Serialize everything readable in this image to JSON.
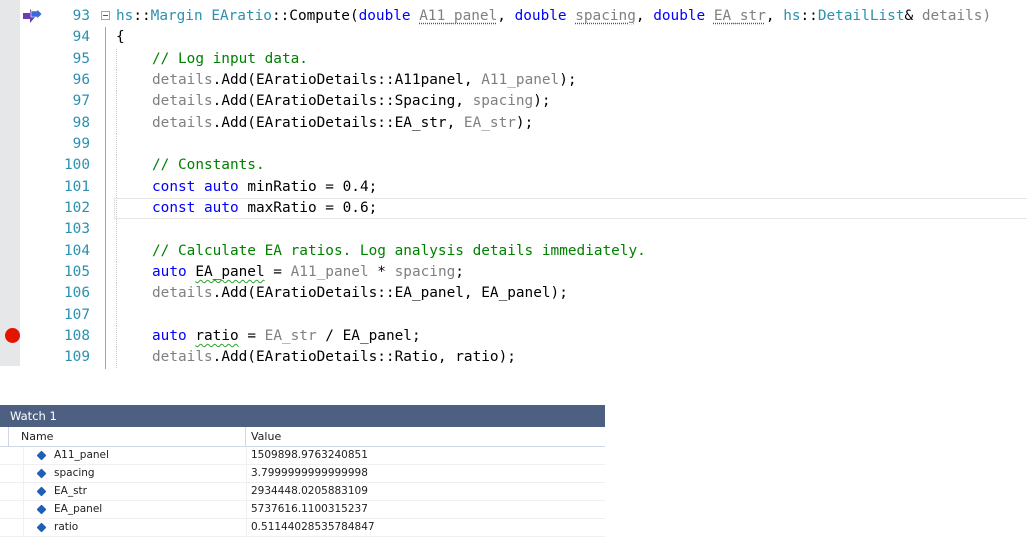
{
  "editor": {
    "lines": [
      {
        "num": "93",
        "tokens": [
          {
            "t": "hs",
            "c": "ty"
          },
          {
            "t": "::",
            "c": ""
          },
          {
            "t": "Margin",
            "c": "ty"
          },
          {
            "t": " ",
            "c": ""
          },
          {
            "t": "EAratio",
            "c": "ty"
          },
          {
            "t": "::",
            "c": ""
          },
          {
            "t": "Compute(",
            "c": ""
          },
          {
            "t": "double",
            "c": "kw"
          },
          {
            "t": " ",
            "c": ""
          },
          {
            "t": "A11_panel",
            "c": "pm dq"
          },
          {
            "t": ", ",
            "c": ""
          },
          {
            "t": "double",
            "c": "kw"
          },
          {
            "t": " ",
            "c": ""
          },
          {
            "t": "spacing",
            "c": "pm dq"
          },
          {
            "t": ", ",
            "c": ""
          },
          {
            "t": "double",
            "c": "kw"
          },
          {
            "t": " ",
            "c": ""
          },
          {
            "t": "EA_str",
            "c": "pm dq"
          },
          {
            "t": ", ",
            "c": ""
          },
          {
            "t": "hs",
            "c": "ty"
          },
          {
            "t": "::",
            "c": ""
          },
          {
            "t": "DetailList",
            "c": "ty"
          },
          {
            "t": "& ",
            "c": ""
          },
          {
            "t": "details)",
            "c": "pm"
          }
        ]
      },
      {
        "num": "94",
        "tokens": [
          {
            "t": "{",
            "c": ""
          }
        ]
      },
      {
        "num": "95",
        "indent": 1,
        "tokens": [
          {
            "t": "// Log input data.",
            "c": "cm"
          }
        ]
      },
      {
        "num": "96",
        "indent": 1,
        "tokens": [
          {
            "t": "details",
            "c": "pm"
          },
          {
            "t": ".Add(EAratioDetails::A11panel, ",
            "c": ""
          },
          {
            "t": "A11_panel",
            "c": "pm"
          },
          {
            "t": ");",
            "c": ""
          }
        ]
      },
      {
        "num": "97",
        "indent": 1,
        "tokens": [
          {
            "t": "details",
            "c": "pm"
          },
          {
            "t": ".Add(EAratioDetails::Spacing, ",
            "c": ""
          },
          {
            "t": "spacing",
            "c": "pm"
          },
          {
            "t": ");",
            "c": ""
          }
        ]
      },
      {
        "num": "98",
        "indent": 1,
        "tokens": [
          {
            "t": "details",
            "c": "pm"
          },
          {
            "t": ".Add(EAratioDetails::EA_str, ",
            "c": ""
          },
          {
            "t": "EA_str",
            "c": "pm"
          },
          {
            "t": ");",
            "c": ""
          }
        ]
      },
      {
        "num": "99",
        "indent": 1,
        "tokens": []
      },
      {
        "num": "100",
        "indent": 1,
        "tokens": [
          {
            "t": "// Constants.",
            "c": "cm"
          }
        ]
      },
      {
        "num": "101",
        "indent": 1,
        "tokens": [
          {
            "t": "const",
            "c": "kw"
          },
          {
            "t": " ",
            "c": ""
          },
          {
            "t": "auto",
            "c": "kw"
          },
          {
            "t": " minRatio = 0.4;",
            "c": ""
          }
        ]
      },
      {
        "num": "102",
        "indent": 1,
        "current": true,
        "tokens": [
          {
            "t": "const",
            "c": "kw"
          },
          {
            "t": " ",
            "c": ""
          },
          {
            "t": "auto",
            "c": "kw"
          },
          {
            "t": " maxRatio = 0.6;",
            "c": ""
          }
        ]
      },
      {
        "num": "103",
        "indent": 1,
        "tokens": []
      },
      {
        "num": "104",
        "indent": 1,
        "tokens": [
          {
            "t": "// Calculate EA ratios. Log analysis details immediately.",
            "c": "cm"
          }
        ]
      },
      {
        "num": "105",
        "indent": 1,
        "tokens": [
          {
            "t": "auto",
            "c": "kw"
          },
          {
            "t": " ",
            "c": ""
          },
          {
            "t": "EA_panel",
            "c": "sq"
          },
          {
            "t": " = ",
            "c": ""
          },
          {
            "t": "A11_panel",
            "c": "pm"
          },
          {
            "t": " * ",
            "c": ""
          },
          {
            "t": "spacing",
            "c": "pm"
          },
          {
            "t": ";",
            "c": ""
          }
        ]
      },
      {
        "num": "106",
        "indent": 1,
        "tokens": [
          {
            "t": "details",
            "c": "pm"
          },
          {
            "t": ".Add(EAratioDetails::EA_panel, EA_panel);",
            "c": ""
          }
        ]
      },
      {
        "num": "107",
        "indent": 1,
        "tokens": []
      },
      {
        "num": "108",
        "indent": 1,
        "tokens": [
          {
            "t": "auto",
            "c": "kw"
          },
          {
            "t": " ",
            "c": ""
          },
          {
            "t": "ratio",
            "c": "sq"
          },
          {
            "t": " = ",
            "c": ""
          },
          {
            "t": "EA_str",
            "c": "pm"
          },
          {
            "t": " / EA_panel;",
            "c": ""
          }
        ]
      },
      {
        "num": "109",
        "indent": 1,
        "tokens": [
          {
            "t": "details",
            "c": "pm"
          },
          {
            "t": ".Add(EAratioDetails::Ratio, ratio);",
            "c": ""
          }
        ]
      }
    ],
    "breakpoint_line": "108",
    "colors": {
      "keyword": "#0000ff",
      "type": "#2b91af",
      "comment": "#008000",
      "parameter": "#808080",
      "breakpoint": "#e51400"
    }
  },
  "watch": {
    "title": "Watch 1",
    "columns": {
      "name": "Name",
      "value": "Value"
    },
    "rows": [
      {
        "name": "A11_panel",
        "value": "1509898.9763240851"
      },
      {
        "name": "spacing",
        "value": "3.7999999999999998"
      },
      {
        "name": "EA_str",
        "value": "2934448.0205883109"
      },
      {
        "name": "EA_panel",
        "value": "5737616.1100315237"
      },
      {
        "name": "ratio",
        "value": "0.51144028535784847"
      }
    ],
    "row_icon": "field-diamond-icon"
  }
}
